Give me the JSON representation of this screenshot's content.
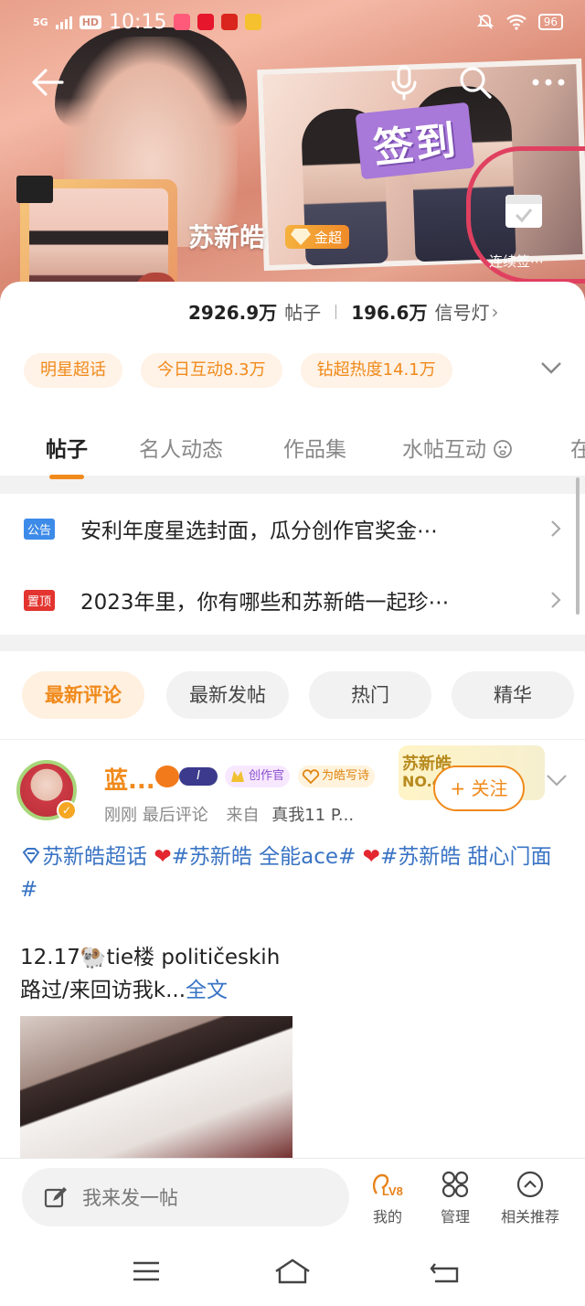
{
  "status_bar": {
    "network": "5G",
    "hd": "HD",
    "time": "10:15",
    "battery": "96"
  },
  "header": {
    "topic_name": "苏新皓",
    "gold_badge": "金超",
    "sign_in_sticker": "签到",
    "checkin_label": "连续签⋯"
  },
  "stats": {
    "posts_value": "2926.9万",
    "posts_label": "帖子",
    "signal_value": "196.6万",
    "signal_label": "信号灯",
    "arrow": "›"
  },
  "chips": [
    "明星超话",
    "今日互动8.3万",
    "钻超热度14.1万"
  ],
  "tabs": [
    "帖子",
    "名人动态",
    "作品集",
    "水帖互动",
    "在"
  ],
  "notices": [
    {
      "tag": "公告",
      "tag_color": "#3d8be8",
      "text": "安利年度星选封面，瓜分创作官奖金⋯"
    },
    {
      "tag": "置顶",
      "tag_color": "#e3342f",
      "text": "2023年里，你有哪些和苏新皓一起珍⋯"
    }
  ],
  "filters": [
    "最新评论",
    "最新发帖",
    "热门",
    "精华"
  ],
  "post": {
    "username": "蓝...",
    "level_badge": "I",
    "badge_creator": "创作官",
    "badge_poem": "为皓写诗",
    "rank_name": "苏新皓",
    "rank_no": "NO.4",
    "follow_label": "+ 关注",
    "meta_time": "刚刚 最后评论",
    "meta_from": "来自",
    "meta_device": "真我11 P...",
    "tag_line": [
      "苏新皓超话",
      "#苏新皓 全能ace#",
      "#苏新皓 甜心门面#"
    ],
    "body_line1": "12.17🐏tie楼 političeskih",
    "body_line2": "路过/来回访我k...",
    "more": "全文"
  },
  "bottom": {
    "compose_placeholder": "我来发一帖",
    "nav": [
      {
        "label": "我的",
        "sub": "LV8"
      },
      {
        "label": "管理"
      },
      {
        "label": "相关推荐"
      }
    ]
  },
  "colors": {
    "accent": "#f08a1b",
    "link": "#3a74c4",
    "notice_blue": "#3d8be8",
    "notice_red": "#e3342f"
  }
}
